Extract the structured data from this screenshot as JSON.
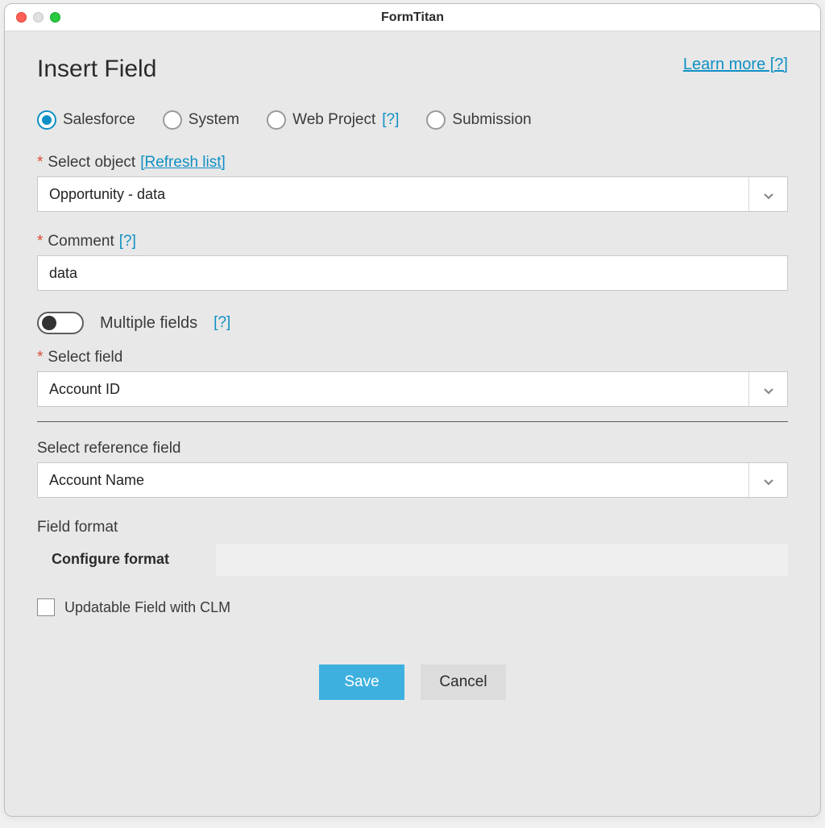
{
  "window": {
    "title": "FormTitan"
  },
  "header": {
    "page_title": "Insert Field",
    "learn_more": "Learn more [?]"
  },
  "source_radios": {
    "selected": "salesforce",
    "options": {
      "salesforce": "Salesforce",
      "system": "System",
      "web_project": "Web Project",
      "web_project_help": "[?]",
      "submission": "Submission"
    }
  },
  "select_object": {
    "label": "Select object",
    "refresh_link": "[Refresh list]",
    "value": "Opportunity - data"
  },
  "comment": {
    "label": "Comment",
    "help": "[?]",
    "value": "data"
  },
  "multiple_fields": {
    "label": "Multiple fields",
    "help": "[?]",
    "enabled": false
  },
  "select_field": {
    "label": "Select field",
    "value": "Account ID"
  },
  "reference_field": {
    "label": "Select reference field",
    "value": "Account Name"
  },
  "field_format": {
    "label": "Field format",
    "configure_label": "Configure format"
  },
  "updatable": {
    "label": "Updatable Field with CLM",
    "checked": false
  },
  "buttons": {
    "save": "Save",
    "cancel": "Cancel"
  }
}
